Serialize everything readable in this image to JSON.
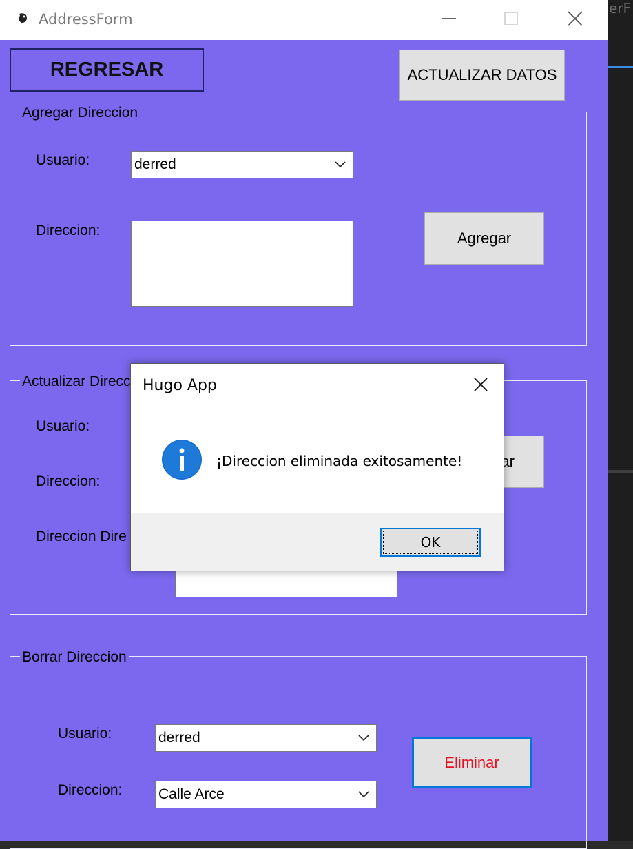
{
  "background": {
    "ide_text": "erF",
    "accent": "#3d8be8"
  },
  "window": {
    "title": "AddressForm",
    "bg_color": "#7b68ee"
  },
  "top": {
    "regresar_label": "REGRESAR",
    "actualizar_datos_label": "ACTUALIZAR DATOS"
  },
  "agregar": {
    "title": "Agregar Direccion",
    "usuario_label": "Usuario:",
    "usuario_value": "derred",
    "direccion_label": "Direccion:",
    "direccion_value": "",
    "button_label": "Agregar"
  },
  "actualizar": {
    "title": "Actualizar Direcc",
    "usuario_label": "Usuario:",
    "direccion_label": "Direccion:",
    "direccion_dire_label": "Direccion Dire",
    "button_label_partial": "ar"
  },
  "borrar": {
    "title": "Borrar Direccion",
    "usuario_label": "Usuario:",
    "usuario_value": "derred",
    "direccion_label": "Direccion:",
    "direccion_value": "Calle Arce",
    "button_label": "Eliminar",
    "button_text_color": "#e81123"
  },
  "dialog": {
    "title": "Hugo App",
    "message": "¡Direccion eliminada exitosamente!",
    "icon": "info-icon",
    "ok_label": "OK",
    "accent": "#0078d7"
  }
}
